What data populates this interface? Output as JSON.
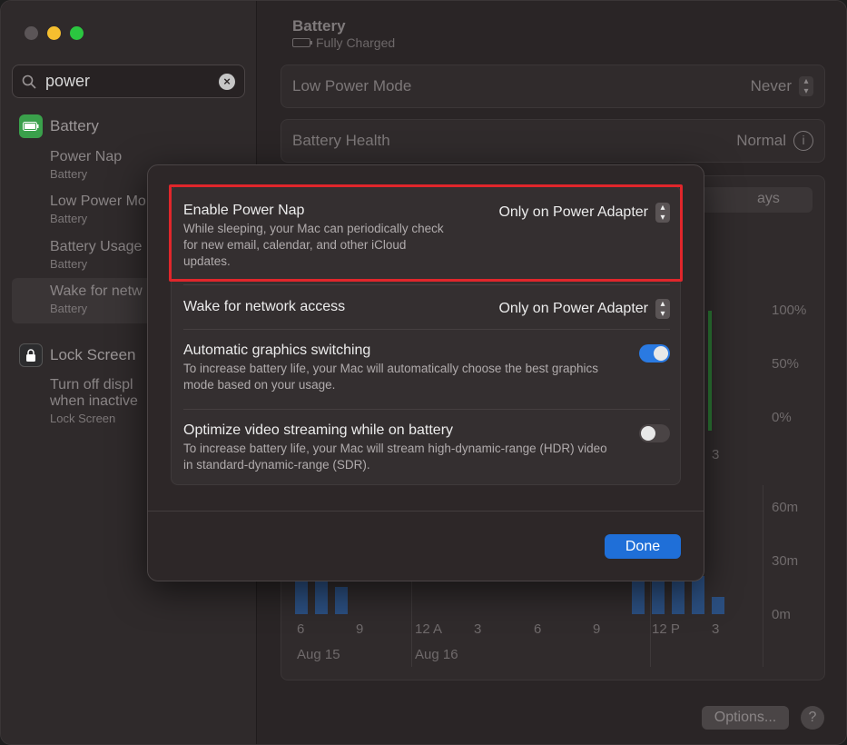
{
  "sidebar": {
    "search": {
      "value": "power"
    },
    "sections": [
      {
        "title": "Battery",
        "icon": "battery-icon"
      },
      {
        "title": "Lock Screen",
        "icon": "lock-icon"
      }
    ],
    "items": [
      {
        "title": "Power Nap",
        "subtitle": "Battery"
      },
      {
        "title": "Low Power Mo",
        "subtitle": "Battery"
      },
      {
        "title": "Battery Usage",
        "subtitle": "Battery"
      },
      {
        "title": "Wake for netw",
        "subtitle": "Battery"
      },
      {
        "title": "Turn off displ",
        "title2": "when inactive",
        "subtitle": "Lock Screen"
      }
    ]
  },
  "main": {
    "title": "Battery",
    "subtitle": "Fully Charged",
    "low_power": {
      "label": "Low Power Mode",
      "value": "Never"
    },
    "health": {
      "label": "Battery Health",
      "value": "Normal"
    },
    "segment_partial": "ays",
    "level_axis": [
      "100%",
      "50%",
      "0%"
    ],
    "level_axis_tick": "3",
    "usage_axis": [
      "60m",
      "30m",
      "0m"
    ],
    "x_ticks": [
      "6",
      "9",
      "12 A",
      "3",
      "6",
      "9",
      "12 P",
      "3"
    ],
    "x_dates": [
      "Aug 15",
      "Aug 16"
    ],
    "options_button": "Options...",
    "help_button": "?"
  },
  "modal": {
    "power_nap": {
      "title": "Enable Power Nap",
      "description": "While sleeping, your Mac can periodically check for new email, calendar, and other iCloud updates.",
      "value": "Only on Power Adapter"
    },
    "wake_network": {
      "title": "Wake for network access",
      "value": "Only on Power Adapter"
    },
    "graphics": {
      "title": "Automatic graphics switching",
      "description": "To increase battery life, your Mac will automatically choose the best graphics mode based on your usage.",
      "enabled": true
    },
    "video": {
      "title": "Optimize video streaming while on battery",
      "description": "To increase battery life, your Mac will stream high-dynamic-range (HDR) video in standard-dynamic-range (SDR).",
      "enabled": false
    },
    "done_button": "Done"
  },
  "colors": {
    "accent": "#1f6fd8",
    "highlight": "#e0262b",
    "battery_green": "#3aa04b"
  }
}
